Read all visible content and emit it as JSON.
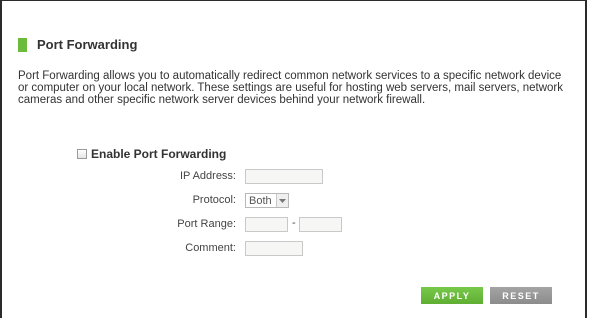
{
  "section": {
    "title": "Port Forwarding",
    "accent_color": "#6dbb3c",
    "description": "Port Forwarding allows you to automatically redirect common network services to a specific network device or computer on your local network. These settings are useful for hosting web servers, mail servers, network cameras and other specific network server devices behind your network firewall."
  },
  "form": {
    "enable_label": "Enable Port Forwarding",
    "enable_checked": false,
    "ip_address_label": "IP Address:",
    "ip_address_value": "",
    "protocol_label": "Protocol:",
    "protocol_value": "Both",
    "port_range_label": "Port Range:",
    "port_range_separator": "-",
    "port_start_value": "",
    "port_end_value": "",
    "comment_label": "Comment:",
    "comment_value": ""
  },
  "buttons": {
    "apply_label": "APPLY",
    "apply_color": "#6cbd3f",
    "reset_label": "RESET",
    "reset_color": "#999999"
  }
}
